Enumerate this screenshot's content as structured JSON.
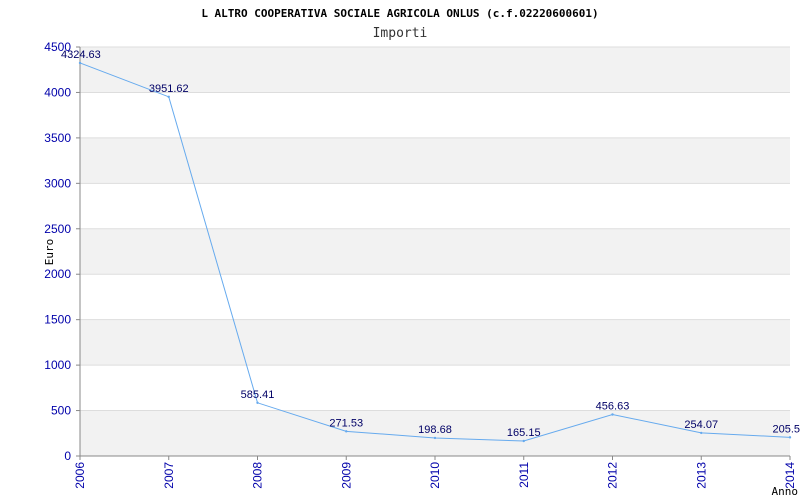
{
  "chart_data": {
    "type": "line",
    "title": "L ALTRO COOPERATIVA SOCIALE AGRICOLA ONLUS (c.f.02220600601)",
    "subtitle": "Importi",
    "ylabel": "Euro",
    "xlabel": "Anno",
    "ylim": [
      0,
      4500
    ],
    "yticks": [
      0,
      500,
      1000,
      1500,
      2000,
      2500,
      3000,
      3500,
      4000,
      4500
    ],
    "categories": [
      "2006",
      "2007",
      "2008",
      "2009",
      "2010",
      "2011",
      "2012",
      "2013",
      "2014"
    ],
    "values": [
      4324.63,
      3951.62,
      585.41,
      271.53,
      198.68,
      165.15,
      456.63,
      254.07,
      205.5
    ],
    "data_labels": [
      "4324.63",
      "3951.62",
      "585.41",
      "271.53",
      "198.68",
      "165.15",
      "456.63",
      "254.07",
      "205.5"
    ],
    "grid": "horizontal alternating bands",
    "colors": {
      "line": "#66aaee",
      "band": "#f2f2f2",
      "grid": "#dddddd",
      "axis": "#888888",
      "tick_text": "#0000aa",
      "label_text": "#000066"
    }
  }
}
